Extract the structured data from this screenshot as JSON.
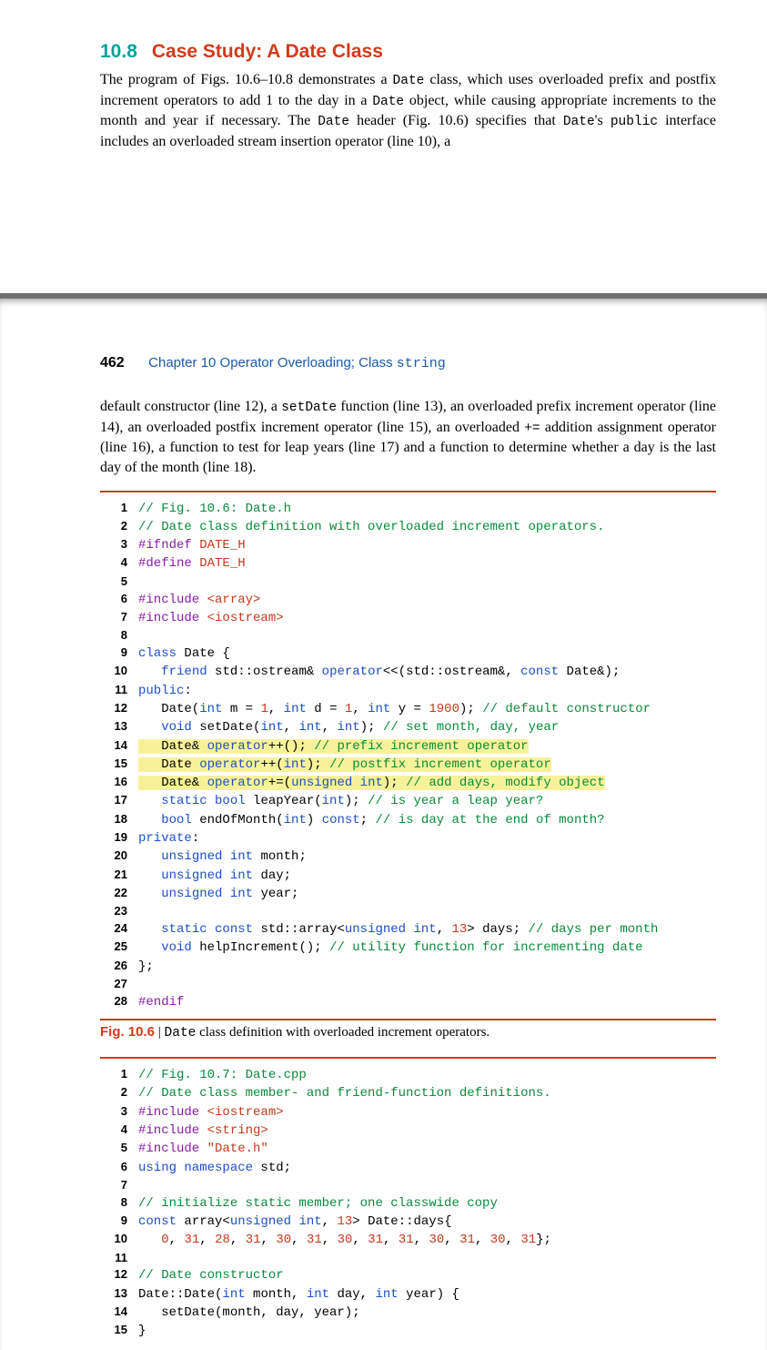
{
  "section": {
    "number": "10.8",
    "title": "Case Study: A Date Class"
  },
  "intro": {
    "t1": "The program of Figs. 10.6–10.8 demonstrates a ",
    "c1": "Date",
    "t2": " class, which uses overloaded prefix and postfix increment operators to add 1 to the day in a ",
    "c2": "Date",
    "t3": " object, while causing appropriate increments to the month and year if necessary. The ",
    "c3": "Date",
    "t4": " header (Fig. 10.6) specifies that ",
    "c4": "Date",
    "t5": "'s ",
    "c5": "public",
    "t6": " interface includes an overloaded stream insertion operator (line 10), a"
  },
  "header": {
    "page": "462",
    "chapA": "Chapter 10   Operator Overloading; Class ",
    "chapB": "string"
  },
  "cont": {
    "t1": "default constructor (line 12), a ",
    "c1": "setDate",
    "t2": " function (line 13), an overloaded prefix increment operator (line 14), an overloaded postfix increment operator (line 15), an overloaded ",
    "c2": "+=",
    "t3": " addition assignment operator (line 16), a function to test for leap years (line 17) and a function to determine whether a day is the last day of the month (line 18)."
  },
  "code1": [
    {
      "n": "1",
      "seg": [
        {
          "cls": "cg",
          "t": "// Fig. 10.6: Date.h"
        }
      ]
    },
    {
      "n": "2",
      "seg": [
        {
          "cls": "cg",
          "t": "// Date class definition with overloaded increment operators."
        }
      ]
    },
    {
      "n": "3",
      "seg": [
        {
          "cls": "cp",
          "t": "#ifndef"
        },
        {
          "cls": "ct",
          "t": " "
        },
        {
          "cls": "cn",
          "t": "DATE_H"
        }
      ]
    },
    {
      "n": "4",
      "seg": [
        {
          "cls": "cp",
          "t": "#define"
        },
        {
          "cls": "ct",
          "t": " "
        },
        {
          "cls": "cn",
          "t": "DATE_H"
        }
      ]
    },
    {
      "n": "5",
      "seg": []
    },
    {
      "n": "6",
      "seg": [
        {
          "cls": "cp",
          "t": "#include"
        },
        {
          "cls": "ct",
          "t": " "
        },
        {
          "cls": "cn",
          "t": "<array>"
        }
      ]
    },
    {
      "n": "7",
      "seg": [
        {
          "cls": "cp",
          "t": "#include"
        },
        {
          "cls": "ct",
          "t": " "
        },
        {
          "cls": "cn",
          "t": "<iostream>"
        }
      ]
    },
    {
      "n": "8",
      "seg": []
    },
    {
      "n": "9",
      "seg": [
        {
          "cls": "cb",
          "t": "class"
        },
        {
          "cls": "ct",
          "t": " Date {"
        }
      ]
    },
    {
      "n": "10",
      "seg": [
        {
          "cls": "ct",
          "t": "   "
        },
        {
          "cls": "cb",
          "t": "friend"
        },
        {
          "cls": "ct",
          "t": " std::ostream& "
        },
        {
          "cls": "cb",
          "t": "operator"
        },
        {
          "cls": "ct",
          "t": "<<(std::ostream&, "
        },
        {
          "cls": "cb",
          "t": "const"
        },
        {
          "cls": "ct",
          "t": " Date&);"
        }
      ]
    },
    {
      "n": "11",
      "seg": [
        {
          "cls": "cb",
          "t": "public"
        },
        {
          "cls": "ct",
          "t": ":"
        }
      ]
    },
    {
      "n": "12",
      "seg": [
        {
          "cls": "ct",
          "t": "   Date("
        },
        {
          "cls": "cb",
          "t": "int"
        },
        {
          "cls": "ct",
          "t": " m = "
        },
        {
          "cls": "cn",
          "t": "1"
        },
        {
          "cls": "ct",
          "t": ", "
        },
        {
          "cls": "cb",
          "t": "int"
        },
        {
          "cls": "ct",
          "t": " d = "
        },
        {
          "cls": "cn",
          "t": "1"
        },
        {
          "cls": "ct",
          "t": ", "
        },
        {
          "cls": "cb",
          "t": "int"
        },
        {
          "cls": "ct",
          "t": " y = "
        },
        {
          "cls": "cn",
          "t": "1900"
        },
        {
          "cls": "ct",
          "t": "); "
        },
        {
          "cls": "cg",
          "t": "// default constructor"
        }
      ]
    },
    {
      "n": "13",
      "seg": [
        {
          "cls": "ct",
          "t": "   "
        },
        {
          "cls": "cb",
          "t": "void"
        },
        {
          "cls": "ct",
          "t": " setDate("
        },
        {
          "cls": "cb",
          "t": "int"
        },
        {
          "cls": "ct",
          "t": ", "
        },
        {
          "cls": "cb",
          "t": "int"
        },
        {
          "cls": "ct",
          "t": ", "
        },
        {
          "cls": "cb",
          "t": "int"
        },
        {
          "cls": "ct",
          "t": "); "
        },
        {
          "cls": "cg",
          "t": "// set month, day, year"
        }
      ]
    },
    {
      "n": "14",
      "hl": true,
      "seg": [
        {
          "cls": "ct",
          "t": "   Date& "
        },
        {
          "cls": "cb",
          "t": "operator"
        },
        {
          "cls": "ct",
          "t": "++(); "
        },
        {
          "cls": "cg",
          "t": "// prefix increment operator"
        }
      ]
    },
    {
      "n": "15",
      "hl": true,
      "seg": [
        {
          "cls": "ct",
          "t": "   Date "
        },
        {
          "cls": "cb",
          "t": "operator"
        },
        {
          "cls": "ct",
          "t": "++("
        },
        {
          "cls": "cb",
          "t": "int"
        },
        {
          "cls": "ct",
          "t": "); "
        },
        {
          "cls": "cg",
          "t": "// postfix increment operator"
        }
      ]
    },
    {
      "n": "16",
      "hl": true,
      "seg": [
        {
          "cls": "ct",
          "t": "   Date& "
        },
        {
          "cls": "cb",
          "t": "operator"
        },
        {
          "cls": "ct",
          "t": "+=("
        },
        {
          "cls": "cb",
          "t": "unsigned int"
        },
        {
          "cls": "ct",
          "t": "); "
        },
        {
          "cls": "cg",
          "t": "// add days, modify object"
        }
      ]
    },
    {
      "n": "17",
      "seg": [
        {
          "cls": "ct",
          "t": "   "
        },
        {
          "cls": "cb",
          "t": "static bool"
        },
        {
          "cls": "ct",
          "t": " leapYear("
        },
        {
          "cls": "cb",
          "t": "int"
        },
        {
          "cls": "ct",
          "t": "); "
        },
        {
          "cls": "cg",
          "t": "// is year a leap year?"
        }
      ]
    },
    {
      "n": "18",
      "seg": [
        {
          "cls": "ct",
          "t": "   "
        },
        {
          "cls": "cb",
          "t": "bool"
        },
        {
          "cls": "ct",
          "t": " endOfMonth("
        },
        {
          "cls": "cb",
          "t": "int"
        },
        {
          "cls": "ct",
          "t": ") "
        },
        {
          "cls": "cb",
          "t": "const"
        },
        {
          "cls": "ct",
          "t": "; "
        },
        {
          "cls": "cg",
          "t": "// is day at the end of month?"
        }
      ]
    },
    {
      "n": "19",
      "seg": [
        {
          "cls": "cb",
          "t": "private"
        },
        {
          "cls": "ct",
          "t": ":"
        }
      ]
    },
    {
      "n": "20",
      "seg": [
        {
          "cls": "ct",
          "t": "   "
        },
        {
          "cls": "cb",
          "t": "unsigned int"
        },
        {
          "cls": "ct",
          "t": " month;"
        }
      ]
    },
    {
      "n": "21",
      "seg": [
        {
          "cls": "ct",
          "t": "   "
        },
        {
          "cls": "cb",
          "t": "unsigned int"
        },
        {
          "cls": "ct",
          "t": " day;"
        }
      ]
    },
    {
      "n": "22",
      "seg": [
        {
          "cls": "ct",
          "t": "   "
        },
        {
          "cls": "cb",
          "t": "unsigned int"
        },
        {
          "cls": "ct",
          "t": " year;"
        }
      ]
    },
    {
      "n": "23",
      "seg": []
    },
    {
      "n": "24",
      "seg": [
        {
          "cls": "ct",
          "t": "   "
        },
        {
          "cls": "cb",
          "t": "static const"
        },
        {
          "cls": "ct",
          "t": " std::array<"
        },
        {
          "cls": "cb",
          "t": "unsigned int"
        },
        {
          "cls": "ct",
          "t": ", "
        },
        {
          "cls": "cn",
          "t": "13"
        },
        {
          "cls": "ct",
          "t": "> days; "
        },
        {
          "cls": "cg",
          "t": "// days per month"
        }
      ]
    },
    {
      "n": "25",
      "seg": [
        {
          "cls": "ct",
          "t": "   "
        },
        {
          "cls": "cb",
          "t": "void"
        },
        {
          "cls": "ct",
          "t": " helpIncrement(); "
        },
        {
          "cls": "cg",
          "t": "// utility function for incrementing date"
        }
      ]
    },
    {
      "n": "26",
      "seg": [
        {
          "cls": "ct",
          "t": "};"
        }
      ]
    },
    {
      "n": "27",
      "seg": []
    },
    {
      "n": "28",
      "seg": [
        {
          "cls": "cp",
          "t": "#endif"
        }
      ]
    }
  ],
  "cap1": {
    "label": "Fig. 10.6",
    "sep": " | ",
    "codeA": "Date",
    "txt": " class definition with overloaded increment operators."
  },
  "code2": [
    {
      "n": "1",
      "seg": [
        {
          "cls": "cg",
          "t": "// Fig. 10.7: Date.cpp"
        }
      ]
    },
    {
      "n": "2",
      "seg": [
        {
          "cls": "cg",
          "t": "// Date class member- and friend-function definitions."
        }
      ]
    },
    {
      "n": "3",
      "seg": [
        {
          "cls": "cp",
          "t": "#include"
        },
        {
          "cls": "ct",
          "t": " "
        },
        {
          "cls": "cn",
          "t": "<iostream>"
        }
      ]
    },
    {
      "n": "4",
      "seg": [
        {
          "cls": "cp",
          "t": "#include"
        },
        {
          "cls": "ct",
          "t": " "
        },
        {
          "cls": "cn",
          "t": "<string>"
        }
      ]
    },
    {
      "n": "5",
      "seg": [
        {
          "cls": "cp",
          "t": "#include"
        },
        {
          "cls": "ct",
          "t": " "
        },
        {
          "cls": "cn",
          "t": "\"Date.h\""
        }
      ]
    },
    {
      "n": "6",
      "seg": [
        {
          "cls": "cb",
          "t": "using namespace"
        },
        {
          "cls": "ct",
          "t": " std;"
        }
      ]
    },
    {
      "n": "7",
      "seg": []
    },
    {
      "n": "8",
      "seg": [
        {
          "cls": "cg",
          "t": "// initialize static member; one classwide copy"
        }
      ]
    },
    {
      "n": "9",
      "seg": [
        {
          "cls": "cb",
          "t": "const"
        },
        {
          "cls": "ct",
          "t": " array<"
        },
        {
          "cls": "cb",
          "t": "unsigned int"
        },
        {
          "cls": "ct",
          "t": ", "
        },
        {
          "cls": "cn",
          "t": "13"
        },
        {
          "cls": "ct",
          "t": "> Date::days{"
        }
      ]
    },
    {
      "n": "10",
      "seg": [
        {
          "cls": "ct",
          "t": "   "
        },
        {
          "cls": "cn",
          "t": "0"
        },
        {
          "cls": "ct",
          "t": ", "
        },
        {
          "cls": "cn",
          "t": "31"
        },
        {
          "cls": "ct",
          "t": ", "
        },
        {
          "cls": "cn",
          "t": "28"
        },
        {
          "cls": "ct",
          "t": ", "
        },
        {
          "cls": "cn",
          "t": "31"
        },
        {
          "cls": "ct",
          "t": ", "
        },
        {
          "cls": "cn",
          "t": "30"
        },
        {
          "cls": "ct",
          "t": ", "
        },
        {
          "cls": "cn",
          "t": "31"
        },
        {
          "cls": "ct",
          "t": ", "
        },
        {
          "cls": "cn",
          "t": "30"
        },
        {
          "cls": "ct",
          "t": ", "
        },
        {
          "cls": "cn",
          "t": "31"
        },
        {
          "cls": "ct",
          "t": ", "
        },
        {
          "cls": "cn",
          "t": "31"
        },
        {
          "cls": "ct",
          "t": ", "
        },
        {
          "cls": "cn",
          "t": "30"
        },
        {
          "cls": "ct",
          "t": ", "
        },
        {
          "cls": "cn",
          "t": "31"
        },
        {
          "cls": "ct",
          "t": ", "
        },
        {
          "cls": "cn",
          "t": "30"
        },
        {
          "cls": "ct",
          "t": ", "
        },
        {
          "cls": "cn",
          "t": "31"
        },
        {
          "cls": "ct",
          "t": "};"
        }
      ]
    },
    {
      "n": "11",
      "seg": []
    },
    {
      "n": "12",
      "seg": [
        {
          "cls": "cg",
          "t": "// Date constructor"
        }
      ]
    },
    {
      "n": "13",
      "seg": [
        {
          "cls": "ct",
          "t": "Date::Date("
        },
        {
          "cls": "cb",
          "t": "int"
        },
        {
          "cls": "ct",
          "t": " month, "
        },
        {
          "cls": "cb",
          "t": "int"
        },
        {
          "cls": "ct",
          "t": " day, "
        },
        {
          "cls": "cb",
          "t": "int"
        },
        {
          "cls": "ct",
          "t": " year) {"
        }
      ]
    },
    {
      "n": "14",
      "seg": [
        {
          "cls": "ct",
          "t": "   setDate(month, day, year);"
        }
      ]
    },
    {
      "n": "15",
      "seg": [
        {
          "cls": "ct",
          "t": "}"
        }
      ]
    }
  ]
}
